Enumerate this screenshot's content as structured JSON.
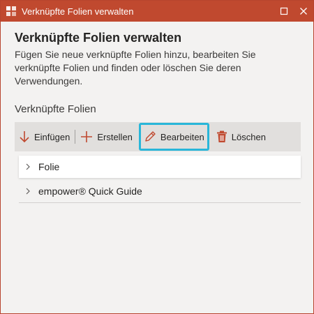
{
  "window": {
    "title": "Verknüpfte Folien verwalten"
  },
  "panel": {
    "heading": "Verknüpfte Folien verwalten",
    "description": "Fügen Sie neue verknüpfte Folien hinzu, bearbeiten Sie verknüpfte Folien und finden oder löschen Sie deren Verwendungen.",
    "section_title": "Verknüpfte Folien"
  },
  "toolbar": {
    "insert_label": "Einfügen",
    "create_label": "Erstellen",
    "edit_label": "Bearbeiten",
    "delete_label": "Löschen"
  },
  "list": {
    "items": [
      {
        "label": "Folie"
      },
      {
        "label": "empower® Quick Guide"
      }
    ]
  },
  "colors": {
    "titlebar": "#c0492f",
    "accent": "#c0492f",
    "highlight": "#29b6d9",
    "toolbar_bg": "#e1dfdd"
  }
}
